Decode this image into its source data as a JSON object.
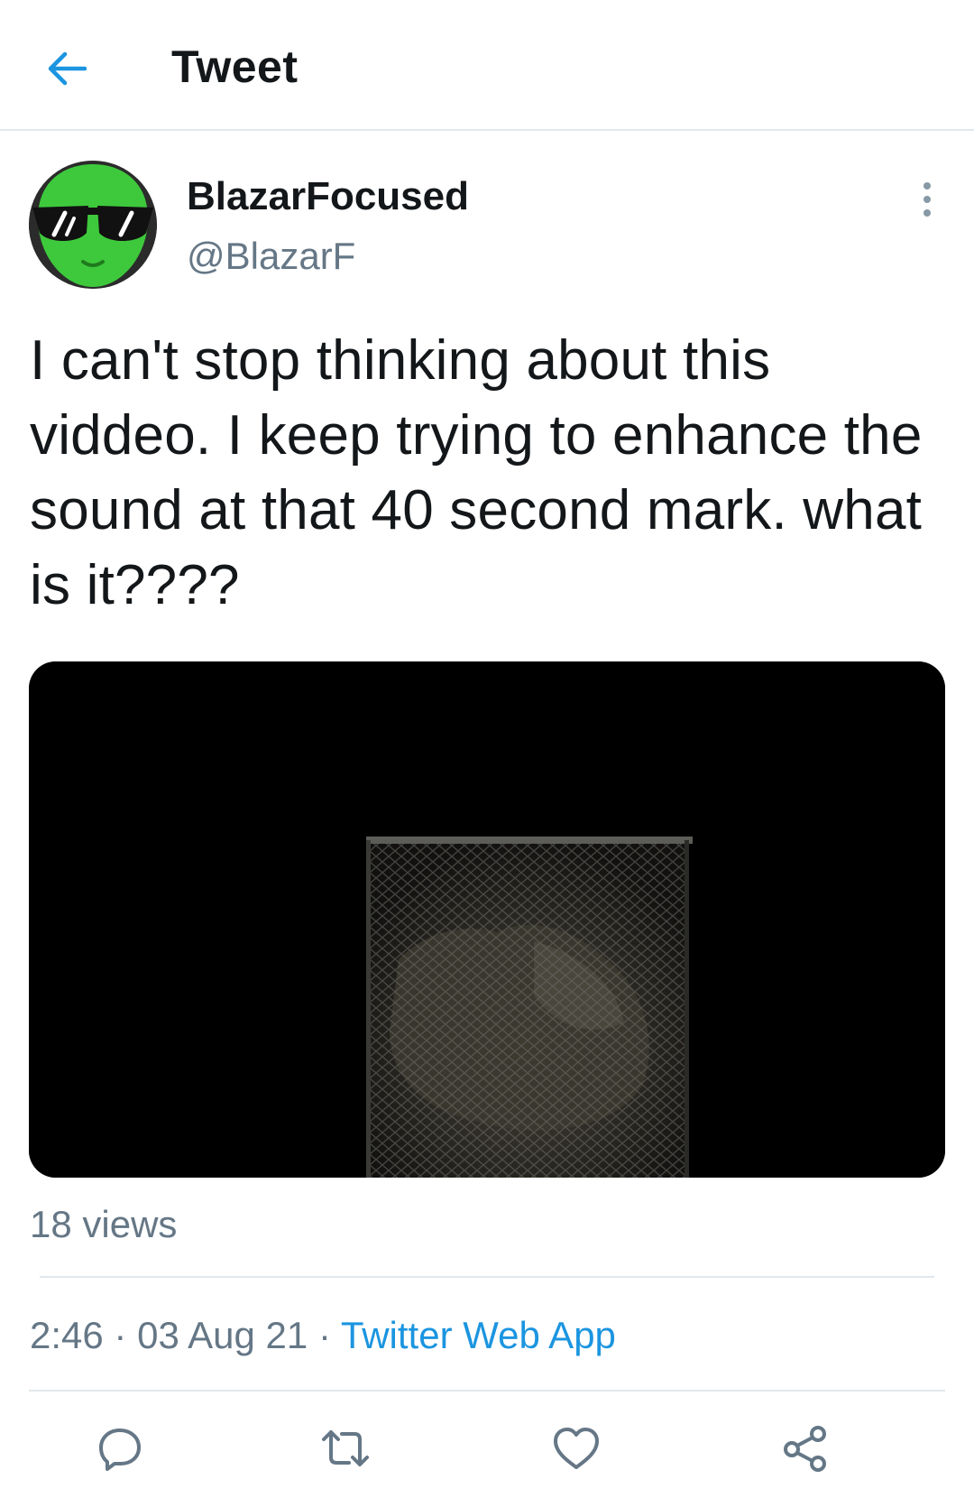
{
  "header": {
    "title": "Tweet",
    "back_icon": "arrow-left-icon"
  },
  "tweet": {
    "author": {
      "display_name": "BlazarFocused",
      "handle": "@BlazarF",
      "avatar_icon": "alien-sunglasses-avatar"
    },
    "text": "I can't stop thinking about this viddeo. I keep trying to enhance the sound at that 40 second mark. what is it????",
    "views": "18 views",
    "time": "2:46",
    "separator": "·",
    "date": "03 Aug 21",
    "source": "Twitter Web App"
  },
  "actions": [
    {
      "name": "reply",
      "icon": "reply-icon"
    },
    {
      "name": "retweet",
      "icon": "retweet-icon"
    },
    {
      "name": "like",
      "icon": "heart-icon"
    },
    {
      "name": "share",
      "icon": "share-icon"
    }
  ],
  "colors": {
    "accent": "#1b95e0",
    "text_primary": "#14171a",
    "text_secondary": "#657786",
    "divider": "#e1e8ed",
    "avatar_green": "#3ec93c"
  }
}
